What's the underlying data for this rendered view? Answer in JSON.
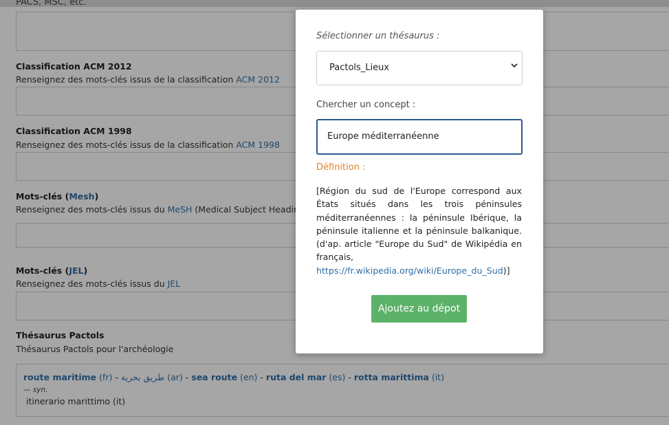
{
  "background_form": {
    "cut_text": "PACS, MSC, etc.",
    "sections": [
      {
        "title": "Classification ACM 2012",
        "description": "Renseignez des mots-clés issus de la classification ",
        "link": "ACM 2012"
      },
      {
        "title": "Classification ACM 1998",
        "description": "Renseignez des mots-clés issus de la classification ",
        "link": "ACM 1998"
      },
      {
        "title_prefix": "Mots-clés (",
        "title_link": "Mesh",
        "title_suffix": ")",
        "description": "Renseignez des mots-clés issus du ",
        "link": "MeSH",
        "description_suffix": " (Medical Subject Headings"
      },
      {
        "title_prefix": "Mots-clés (",
        "title_link": "JEL",
        "title_suffix": ")",
        "description": "Renseignez des mots-clés issus du ",
        "link": "JEL"
      },
      {
        "title": "Thésaurus Pactols",
        "description": "Thésaurus Pactols pour l'archéologie"
      }
    ],
    "pactols_terms": [
      {
        "term": "route maritime",
        "lang": "(fr)"
      },
      {
        "term": "طريق بحرية",
        "lang": "(ar)"
      },
      {
        "term": "sea route",
        "lang": "(en)"
      },
      {
        "term": "ruta del mar",
        "lang": "(es)"
      },
      {
        "term": "rotta marittima",
        "lang": "(it)"
      }
    ],
    "separator": " - ",
    "syn_label": "— syn.",
    "syn_value": "itinerario marittimo (it)"
  },
  "modal": {
    "select_label": "Sélectionner un thésaurus :",
    "select_value": "Pactols_Lieux",
    "search_label": "Chercher un concept :",
    "search_value": "Europe méditerranéenne",
    "definition_label": "Définition :",
    "definition_text": "[Région du sud de l'Europe correspond aux États situés dans les trois péninsules méditerranéennes : la péninsule Ibérique, la péninsule italienne et la péninsule balkanique. (d'ap. article \"Europe du Sud\" de Wikipédia en français, ",
    "definition_link": "https://fr.wikipedia.org/wiki/Europe_du_Sud",
    "definition_end": ")]",
    "add_button": "Ajoutez au dépot"
  },
  "colors": {
    "link": "#2f6fa8",
    "definition_label": "#e0822a",
    "button": "#5cb269",
    "search_border": "#2c5a8c"
  }
}
